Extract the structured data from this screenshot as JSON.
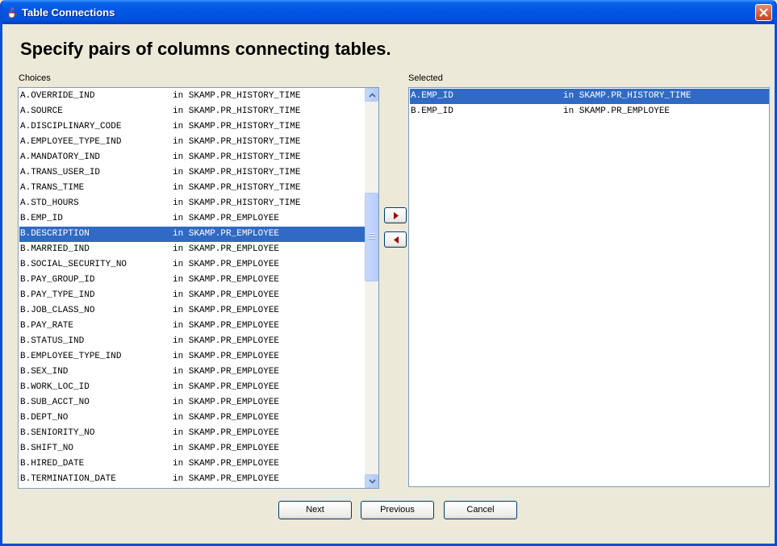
{
  "window": {
    "title": "Table Connections",
    "close_icon": "close-x-icon",
    "app_icon": "java-cup-icon"
  },
  "heading": "Specify pairs of columns connecting tables.",
  "choices": {
    "label": "Choices",
    "items": [
      {
        "column": "A.OVERRIDE_IND",
        "table": "in SKAMP.PR_HISTORY_TIME"
      },
      {
        "column": "A.SOURCE",
        "table": "in SKAMP.PR_HISTORY_TIME"
      },
      {
        "column": "A.DISCIPLINARY_CODE",
        "table": "in SKAMP.PR_HISTORY_TIME"
      },
      {
        "column": "A.EMPLOYEE_TYPE_IND",
        "table": "in SKAMP.PR_HISTORY_TIME"
      },
      {
        "column": "A.MANDATORY_IND",
        "table": "in SKAMP.PR_HISTORY_TIME"
      },
      {
        "column": "A.TRANS_USER_ID",
        "table": "in SKAMP.PR_HISTORY_TIME"
      },
      {
        "column": "A.TRANS_TIME",
        "table": "in SKAMP.PR_HISTORY_TIME"
      },
      {
        "column": "A.STD_HOURS",
        "table": "in SKAMP.PR_HISTORY_TIME"
      },
      {
        "column": "B.EMP_ID",
        "table": "in SKAMP.PR_EMPLOYEE"
      },
      {
        "column": "B.DESCRIPTION",
        "table": "in SKAMP.PR_EMPLOYEE"
      },
      {
        "column": "B.MARRIED_IND",
        "table": "in SKAMP.PR_EMPLOYEE"
      },
      {
        "column": "B.SOCIAL_SECURITY_NO",
        "table": "in SKAMP.PR_EMPLOYEE"
      },
      {
        "column": "B.PAY_GROUP_ID",
        "table": "in SKAMP.PR_EMPLOYEE"
      },
      {
        "column": "B.PAY_TYPE_IND",
        "table": "in SKAMP.PR_EMPLOYEE"
      },
      {
        "column": "B.JOB_CLASS_NO",
        "table": "in SKAMP.PR_EMPLOYEE"
      },
      {
        "column": "B.PAY_RATE",
        "table": "in SKAMP.PR_EMPLOYEE"
      },
      {
        "column": "B.STATUS_IND",
        "table": "in SKAMP.PR_EMPLOYEE"
      },
      {
        "column": "B.EMPLOYEE_TYPE_IND",
        "table": "in SKAMP.PR_EMPLOYEE"
      },
      {
        "column": "B.SEX_IND",
        "table": "in SKAMP.PR_EMPLOYEE"
      },
      {
        "column": "B.WORK_LOC_ID",
        "table": "in SKAMP.PR_EMPLOYEE"
      },
      {
        "column": "B.SUB_ACCT_NO",
        "table": "in SKAMP.PR_EMPLOYEE"
      },
      {
        "column": "B.DEPT_NO",
        "table": "in SKAMP.PR_EMPLOYEE"
      },
      {
        "column": "B.SENIORITY_NO",
        "table": "in SKAMP.PR_EMPLOYEE"
      },
      {
        "column": "B.SHIFT_NO",
        "table": "in SKAMP.PR_EMPLOYEE"
      },
      {
        "column": "B.HIRED_DATE",
        "table": "in SKAMP.PR_EMPLOYEE"
      },
      {
        "column": "B.TERMINATION_DATE",
        "table": "in SKAMP.PR_EMPLOYEE"
      }
    ],
    "selected_index": 9
  },
  "selected": {
    "label": "Selected",
    "items": [
      {
        "column": "A.EMP_ID",
        "table": "in SKAMP.PR_HISTORY_TIME"
      },
      {
        "column": "B.EMP_ID",
        "table": "in SKAMP.PR_EMPLOYEE"
      }
    ],
    "selected_index": 0
  },
  "transfer": {
    "add_icon": "arrow-right-icon",
    "remove_icon": "arrow-left-icon"
  },
  "buttons": {
    "next": "Next",
    "previous": "Previous",
    "cancel": "Cancel"
  },
  "colors": {
    "selection": "#316ac5",
    "titlebar": "#0055e5",
    "dialog_bg": "#ece9d8"
  }
}
